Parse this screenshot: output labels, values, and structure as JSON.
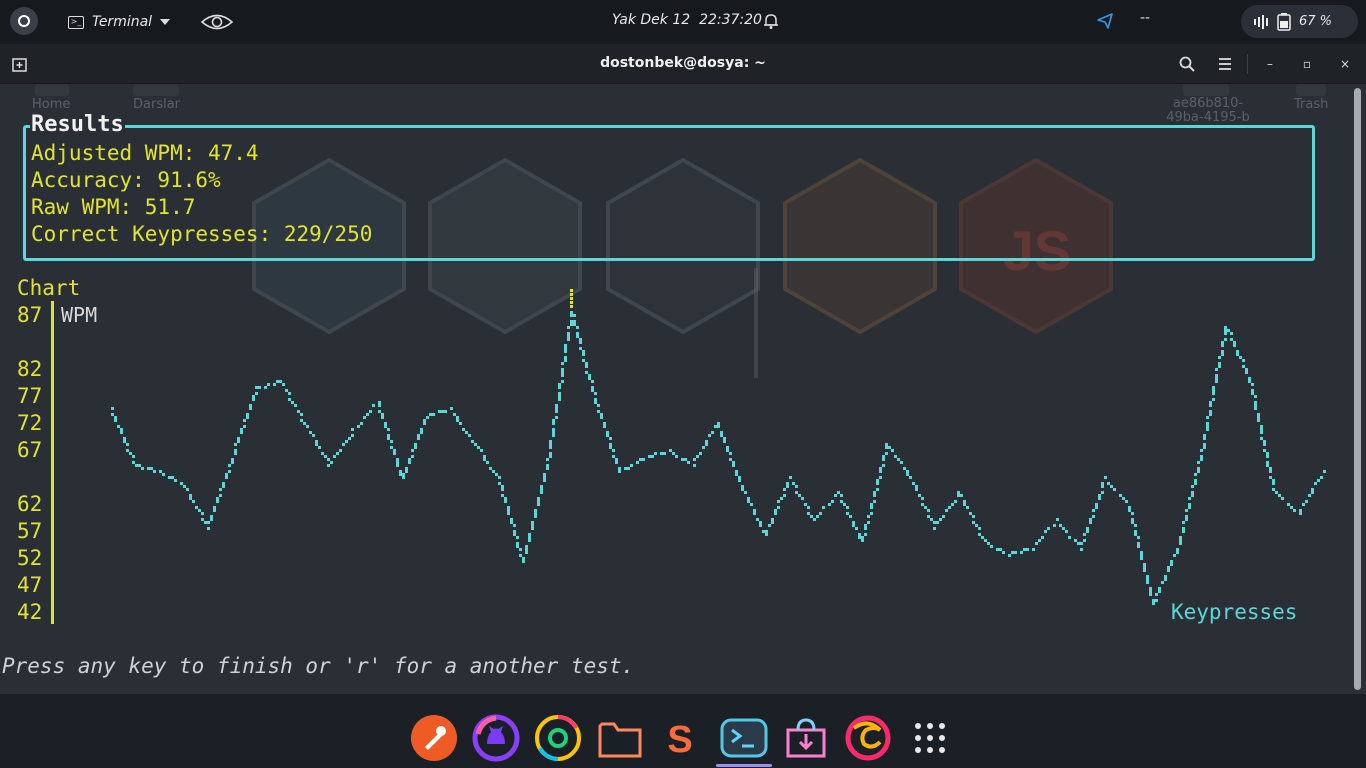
{
  "topbar": {
    "app_name": "Terminal",
    "datetime": "Yak Dek 12  22:37:20",
    "tray_text": "--",
    "battery": "67 %"
  },
  "window": {
    "title": "dostonbek@dosya: ~"
  },
  "desktop_behind": {
    "icons": [
      "Home",
      "Darslar",
      "ae86b810-\n49ba-4195-b",
      "Trash"
    ]
  },
  "results": {
    "title": "Results",
    "lines": [
      "Adjusted WPM: 47.4",
      "Accuracy: 91.6%",
      "Raw WPM: 51.7",
      "Correct Keypresses: 229/250"
    ]
  },
  "chart_data": {
    "type": "line",
    "title": "Chart",
    "ylabel": "WPM",
    "xlabel": "Keypresses",
    "yticks": [
      "87",
      "82",
      "77",
      "72",
      "67",
      "62",
      "57",
      "52",
      "47",
      "42"
    ],
    "ylim": [
      42,
      87
    ],
    "xlim": [
      0,
      250
    ],
    "series": [
      {
        "color": "#5cd6d9",
        "x": [
          0,
          5,
          10,
          15,
          20,
          25,
          30,
          35,
          40,
          45,
          50,
          55,
          60,
          65,
          70,
          75,
          80,
          85,
          90,
          95,
          100,
          105,
          110,
          115,
          120,
          125,
          130,
          135,
          140,
          145,
          150,
          155,
          160,
          165,
          170,
          175,
          180,
          185,
          190,
          195,
          200,
          205,
          210,
          215,
          220,
          225,
          230,
          235,
          240,
          245,
          250
        ],
        "values": [
          72,
          64,
          63,
          61,
          55,
          65,
          75,
          76,
          70,
          64,
          69,
          73,
          62,
          71,
          72,
          67,
          62,
          50,
          64,
          86,
          73,
          63,
          65,
          66,
          64,
          70,
          61,
          54,
          62,
          56,
          60,
          53,
          67,
          62,
          55,
          60,
          53,
          51,
          52,
          56,
          52,
          62,
          58,
          44,
          52,
          66,
          84,
          76,
          60,
          57,
          63
        ]
      }
    ],
    "grid": false,
    "legend": "none"
  },
  "footer_prompt": "Press any key to finish or 'r' for a another test.",
  "dock": {
    "apps": [
      "postman",
      "github-desktop",
      "chrome",
      "files",
      "sublime",
      "terminal",
      "software-center",
      "firefox-dev",
      "app-grid"
    ]
  }
}
